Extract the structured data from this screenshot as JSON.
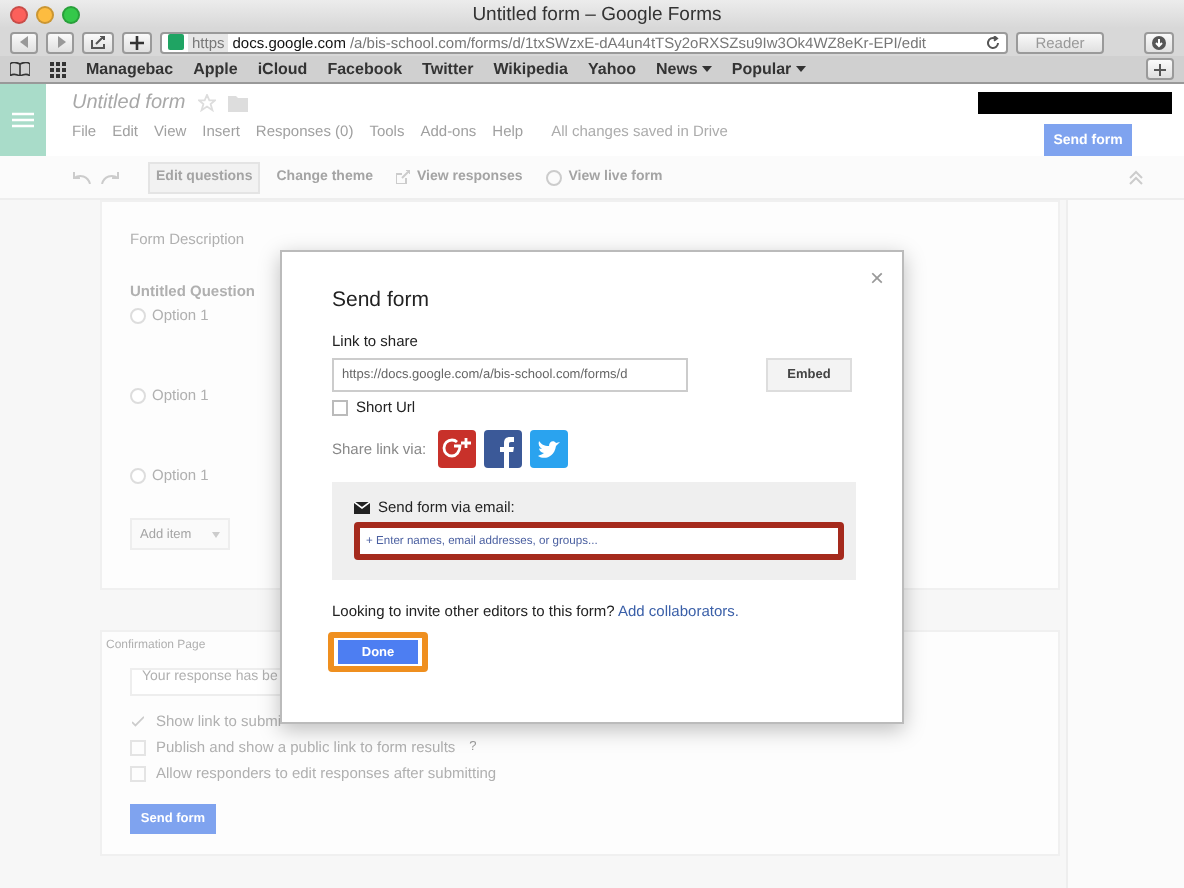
{
  "browser": {
    "title": "Untitled form – Google Forms",
    "url_scheme": "https",
    "url_host": "docs.google.com",
    "url_path": "/a/bis-school.com/forms/d/1txSWzxE-dA4un4tTSy2oRXSZsu9Iw3Ok4WZ8eKr-EPI/edit",
    "reader": "Reader",
    "bookmarks": [
      {
        "label": "Managebac",
        "menu": false
      },
      {
        "label": "Apple",
        "menu": false
      },
      {
        "label": "iCloud",
        "menu": false
      },
      {
        "label": "Facebook",
        "menu": false
      },
      {
        "label": "Twitter",
        "menu": false
      },
      {
        "label": "Wikipedia",
        "menu": false
      },
      {
        "label": "Yahoo",
        "menu": false
      },
      {
        "label": "News",
        "menu": true
      },
      {
        "label": "Popular",
        "menu": true
      }
    ]
  },
  "app": {
    "title": "Untitled form",
    "menus": [
      "File",
      "Edit",
      "View",
      "Insert",
      "Responses (0)",
      "Tools",
      "Add-ons",
      "Help"
    ],
    "save_status": "All changes saved in Drive",
    "send_button": "Send form",
    "toolbar": [
      {
        "label": "Edit questions",
        "kind": "plain",
        "selected": true
      },
      {
        "label": "Change theme",
        "kind": "plain",
        "selected": false
      },
      {
        "label": "View responses",
        "kind": "responses",
        "selected": false
      },
      {
        "label": "View live form",
        "kind": "live",
        "selected": false
      }
    ]
  },
  "form": {
    "description": "Form Description",
    "question": "Untitled Question",
    "options": [
      {
        "label": "Option 1",
        "selected": false
      },
      {
        "label": "Option 1",
        "selected": false
      },
      {
        "label": "Option 1",
        "selected": false
      }
    ],
    "add_item": "Add item"
  },
  "confirmation": {
    "label": "Confirmation Page",
    "message": "Your response has be",
    "options": [
      {
        "label": "Show link to submi",
        "checked": true
      },
      {
        "label": "Publish and show a public link to form results",
        "checked": false,
        "help": "?"
      },
      {
        "label": "Allow responders to edit responses after submitting",
        "checked": false
      }
    ],
    "send_button": "Send form"
  },
  "dialog": {
    "title": "Send form",
    "close": "×",
    "link_label": "Link to share",
    "link": "https://docs.google.com/a/bis-school.com/forms/d",
    "embed": "Embed",
    "short_url": {
      "label": "Short Url",
      "checked": false
    },
    "share_label": "Share link via:",
    "email_label": "Send form via email:",
    "email_placeholder": "+ Enter names, email addresses, or groups...",
    "email_highlighted": true,
    "invite_text": "Looking to invite other editors to this form?",
    "invite_link": "Add collaborators.",
    "done": "Done",
    "done_highlighted": true
  }
}
